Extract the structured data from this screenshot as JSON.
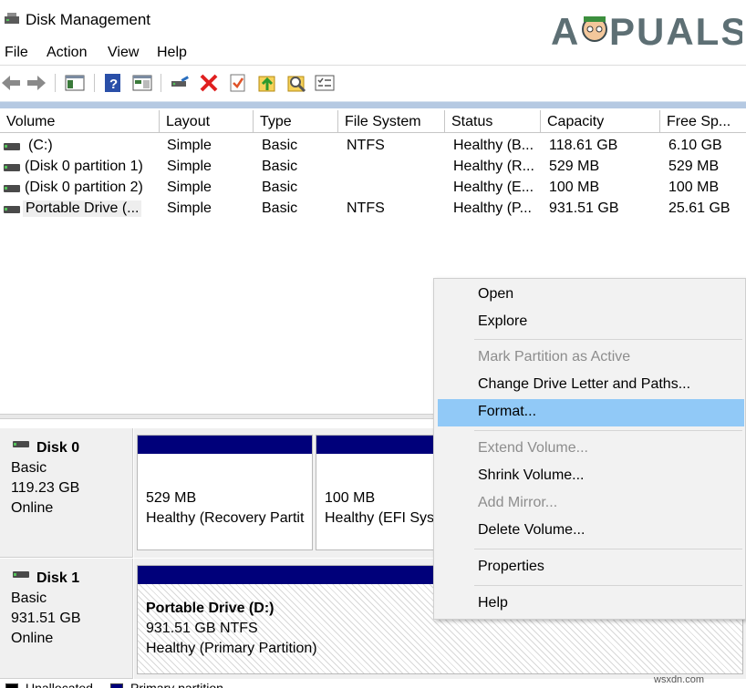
{
  "window": {
    "title": "Disk Management",
    "logo_text": "APPUALS"
  },
  "menubar": {
    "items": [
      "File",
      "Action",
      "View",
      "Help"
    ]
  },
  "toolbar": {
    "icons": [
      "back-arrow-icon",
      "forward-arrow-icon",
      "console-tree-icon",
      "help-icon",
      "properties-icon",
      "connect-icon",
      "delete-icon",
      "check-icon",
      "import-icon",
      "rescan-icon",
      "list-view-icon"
    ]
  },
  "volume_list": {
    "columns": [
      "Volume",
      "Layout",
      "Type",
      "File System",
      "Status",
      "Capacity",
      "Free Sp..."
    ],
    "rows": [
      {
        "volume": "(C:)",
        "layout": "Simple",
        "type": "Basic",
        "fs": "NTFS",
        "status": "Healthy (B...",
        "capacity": "118.61 GB",
        "free": "6.10 GB"
      },
      {
        "volume": "(Disk 0 partition 1)",
        "layout": "Simple",
        "type": "Basic",
        "fs": "",
        "status": "Healthy (R...",
        "capacity": "529 MB",
        "free": "529 MB"
      },
      {
        "volume": "(Disk 0 partition 2)",
        "layout": "Simple",
        "type": "Basic",
        "fs": "",
        "status": "Healthy (E...",
        "capacity": "100 MB",
        "free": "100 MB"
      },
      {
        "volume": "Portable Drive (...",
        "layout": "Simple",
        "type": "Basic",
        "fs": "NTFS",
        "status": "Healthy (P...",
        "capacity": "931.51 GB",
        "free": "25.61 GB"
      }
    ]
  },
  "disks": [
    {
      "name": "Disk 0",
      "type": "Basic",
      "size": "119.23 GB",
      "state": "Online",
      "partitions": [
        {
          "line1": "529 MB",
          "line2": "Healthy (Recovery Partit"
        },
        {
          "line1": "100 MB",
          "line2": "Healthy (EFI Syst"
        }
      ]
    },
    {
      "name": "Disk 1",
      "type": "Basic",
      "size": "931.51 GB",
      "state": "Online",
      "partitions": [
        {
          "title": "Portable Drive  (D:)",
          "line1": "931.51 GB NTFS",
          "line2": "Healthy (Primary Partition)"
        }
      ]
    }
  ],
  "legend": {
    "unallocated": "Unallocated",
    "primary": "Primary partition"
  },
  "context_menu": {
    "items": [
      {
        "label": "Open",
        "disabled": false
      },
      {
        "label": "Explore",
        "disabled": false
      },
      {
        "label": "Mark Partition as Active",
        "disabled": true
      },
      {
        "label": "Change Drive Letter and Paths...",
        "disabled": false
      },
      {
        "label": "Format...",
        "disabled": false,
        "highlighted": true
      },
      {
        "label": "Extend Volume...",
        "disabled": true
      },
      {
        "label": "Shrink Volume...",
        "disabled": false
      },
      {
        "label": "Add Mirror...",
        "disabled": true
      },
      {
        "label": "Delete Volume...",
        "disabled": false
      },
      {
        "label": "Properties",
        "disabled": false
      },
      {
        "label": "Help",
        "disabled": false
      }
    ]
  },
  "watermark": "wsxdn.com",
  "colors": {
    "primary_partition": "#00007a",
    "menu_highlight": "#91c9f7",
    "delete_red": "#e02020"
  }
}
